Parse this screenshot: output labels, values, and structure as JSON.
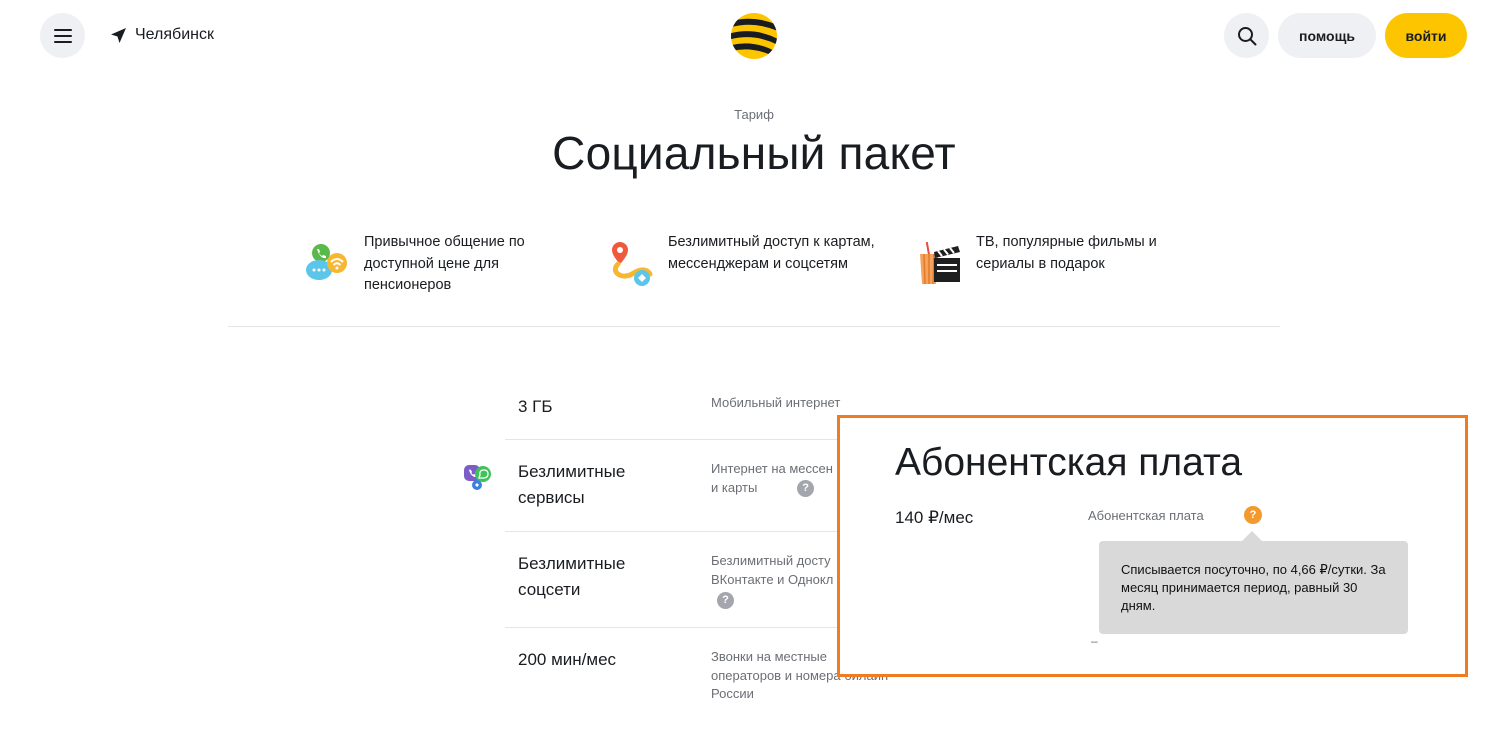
{
  "header": {
    "city": "Челябинск",
    "help_label": "помощь",
    "login_label": "войти",
    "menu_icon": "hamburger-icon",
    "search_icon": "search-icon",
    "location_icon": "navigation-arrow-icon",
    "accent_color": "#fcc500"
  },
  "hero": {
    "overline": "Тариф",
    "title": "Социальный пакет"
  },
  "features": [
    {
      "icon": "chat-bubbles-icon",
      "text": "Привычное общение по доступной цене для пенсионеров"
    },
    {
      "icon": "map-route-icon",
      "text": "Безлимитный доступ к картам, мессенджерам и соцсетям"
    },
    {
      "icon": "cinema-popcorn-icon",
      "text": "ТВ, популярные фильмы и сериалы в подарок"
    }
  ],
  "rows": [
    {
      "value": "3 ГБ",
      "desc": "Мобильный интернет"
    },
    {
      "value": "Безлимитные сервисы",
      "desc": "Интернет на мессен... и карты"
    },
    {
      "value": "Безлимитные соцсети",
      "desc": "Безлимитный досту... ВКонтакте и Однокл..."
    },
    {
      "value": "200 мин/мес",
      "desc": "Звонки на местные операторов и номера билайн России"
    }
  ],
  "rows_text": {
    "r0_value": "3 ГБ",
    "r0_desc": "Мобильный интернет",
    "r1_value_a": "Безлимитные",
    "r1_value_b": "сервисы",
    "r1_desc_a": "Интернет на мессен",
    "r1_desc_b": "и карты",
    "r2_value_a": "Безлимитные",
    "r2_value_b": "соцсети",
    "r2_desc_a": "Безлимитный досту",
    "r2_desc_b": "ВКонтакте и Однокл",
    "r3_value": "200 мин/мес",
    "r3_desc_a": "Звонки на местные",
    "r3_desc_b": "операторов и номера билайн",
    "r3_desc_c": "России"
  },
  "popup": {
    "title": "Абонентская плата",
    "price": "140 ₽/мес",
    "label": "Абонентская плата",
    "help_mark": "?",
    "tooltip": "Списывается посуточно, по 4,66 ₽/сутки. За месяц принимается период, равный 30 дням.",
    "dash": "–",
    "border_color": "#f07c21"
  }
}
